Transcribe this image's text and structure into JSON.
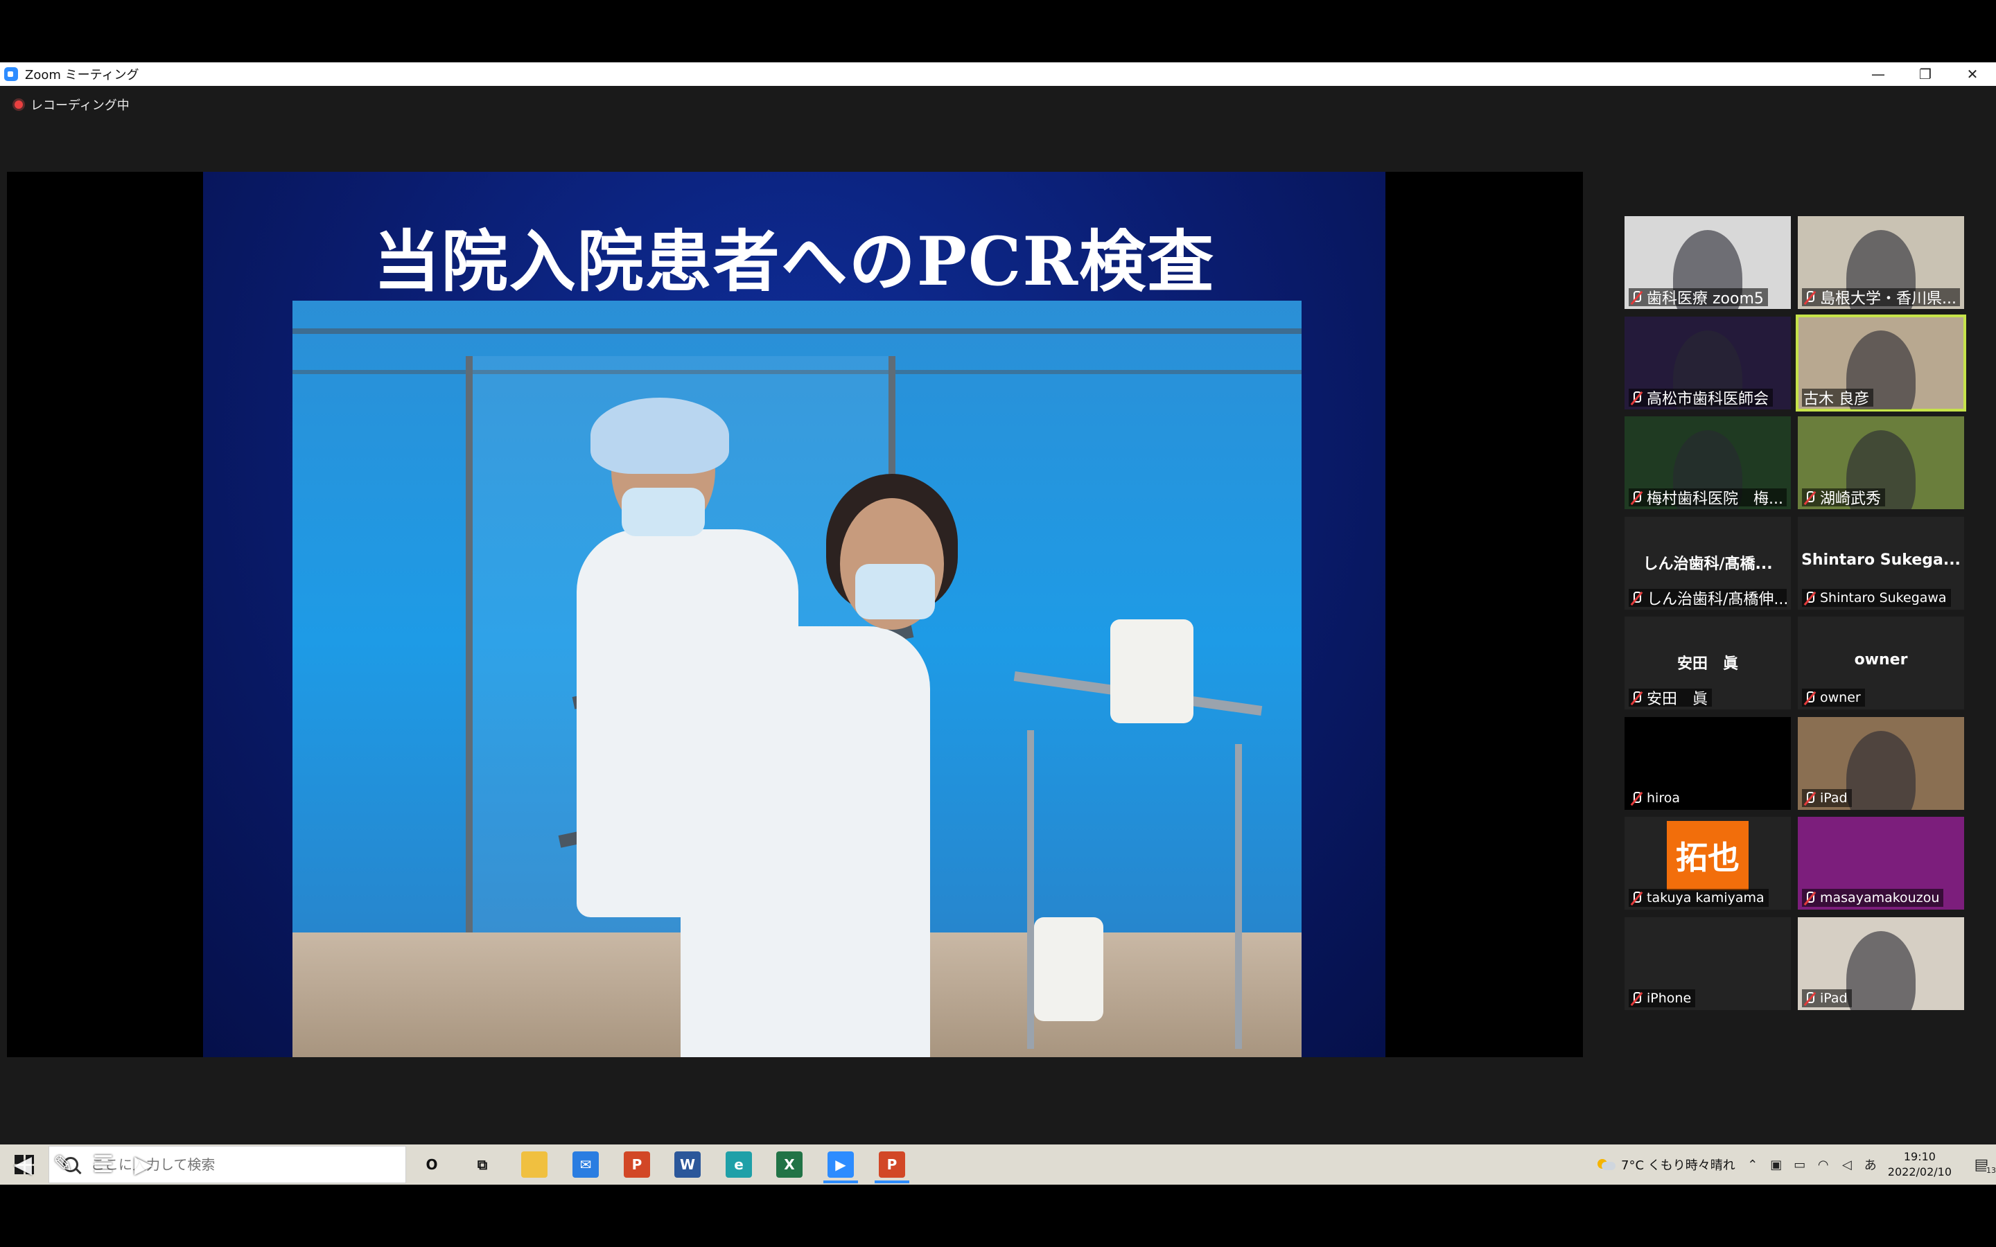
{
  "window": {
    "title": "Zoom ミーティング",
    "controls": {
      "minimize": "—",
      "restore": "❐",
      "close": "✕"
    }
  },
  "recording": {
    "label": "レコーディング中"
  },
  "share": {
    "slide_title": "当院入院患者へのPCR検査"
  },
  "gallery": {
    "participants": [
      {
        "name": "歯科医療 zoom5",
        "center": "",
        "muted": true,
        "kind": "video",
        "bg": "#d8d8d8"
      },
      {
        "name": "島根大学・香川県...",
        "center": "",
        "muted": true,
        "kind": "video",
        "bg": "#c9c2b3"
      },
      {
        "name": "高松市歯科医師会",
        "center": "",
        "muted": true,
        "kind": "video",
        "bg": "#241a3a"
      },
      {
        "name": "古木 良彦",
        "center": "",
        "muted": false,
        "kind": "video",
        "bg": "#b8a890",
        "active": true
      },
      {
        "name": "梅村歯科医院　梅...",
        "center": "",
        "muted": true,
        "kind": "video",
        "bg": "#1f3a22"
      },
      {
        "name": "湖崎武秀",
        "center": "",
        "muted": true,
        "kind": "video",
        "bg": "#6a7e3c"
      },
      {
        "name": "しん治歯科/髙橋伸...",
        "center": "しん治歯科/髙橋...",
        "muted": true,
        "kind": "name",
        "bg": "#232323"
      },
      {
        "name": "Shintaro Sukegawa",
        "center": "Shintaro  Sukega...",
        "muted": true,
        "kind": "name",
        "bg": "#232323"
      },
      {
        "name": "安田　眞",
        "center": "安田　眞",
        "muted": true,
        "kind": "name",
        "bg": "#232323"
      },
      {
        "name": "owner",
        "center": "owner",
        "muted": true,
        "kind": "name",
        "bg": "#232323"
      },
      {
        "name": "hiroa",
        "center": "",
        "muted": true,
        "kind": "black",
        "bg": "#000000"
      },
      {
        "name": "iPad",
        "center": "",
        "muted": true,
        "kind": "video",
        "bg": "#8a6f52"
      },
      {
        "name": "takuya kamiyama",
        "center": "",
        "muted": true,
        "kind": "avatar",
        "bg": "#232323",
        "initials": "拓也"
      },
      {
        "name": "masayamakouzou",
        "center": "",
        "muted": true,
        "kind": "color",
        "bg": "#7c1e7c"
      },
      {
        "name": "iPhone",
        "center": "",
        "muted": true,
        "kind": "name",
        "bg": "#232323"
      },
      {
        "name": "iPad",
        "center": "",
        "muted": true,
        "kind": "video",
        "bg": "#d6cfc4"
      }
    ]
  },
  "taskbar": {
    "search_placeholder": "ここに入力して検索",
    "apps": [
      {
        "icon": "cortana-icon",
        "label": "O",
        "color": "transparent"
      },
      {
        "icon": "task-view-icon",
        "label": "⧉",
        "color": "transparent"
      },
      {
        "icon": "file-explorer-icon",
        "label": "",
        "color": "#f0c040"
      },
      {
        "icon": "mail-icon",
        "label": "✉",
        "color": "#2a7de1"
      },
      {
        "icon": "powerpoint-icon",
        "label": "P",
        "color": "#d24726"
      },
      {
        "icon": "word-icon",
        "label": "W",
        "color": "#2b579a"
      },
      {
        "icon": "edge-icon",
        "label": "e",
        "color": "#1fa0a8"
      },
      {
        "icon": "excel-icon",
        "label": "X",
        "color": "#217346"
      },
      {
        "icon": "zoom-icon",
        "label": "▶",
        "color": "#2d8cff"
      },
      {
        "icon": "powerpoint-icon",
        "label": "P",
        "color": "#d24726"
      }
    ],
    "weather": "7°C くもり時々晴れ",
    "ime": "あ",
    "time": "19:10",
    "date": "2022/02/10",
    "notifications": "13"
  }
}
